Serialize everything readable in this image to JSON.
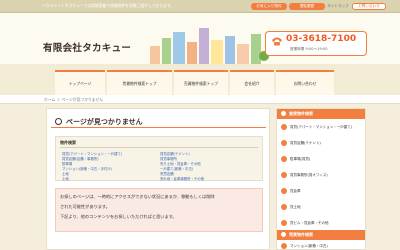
{
  "topbar": {
    "tagline": "ハウスメイトタカキューでは地域密着で賃貸物件を多数ご紹介しております。",
    "favorite_label": "お気に入り物件",
    "history_label": "閲覧履歴",
    "sitemap_label": "サイトマップ",
    "contact_label": "お問い合わせ"
  },
  "header": {
    "logo": "有限会社タカキュー",
    "phone": "03-3618-7100",
    "hours": "営業時間 9:00〜19:00"
  },
  "nav": {
    "items": [
      "トップページ",
      "賃貸物件検索トップ",
      "売買物件検索トップ",
      "会社紹介",
      "お問い合わせ"
    ]
  },
  "breadcrumb": {
    "text": "ホーム ＞ ページが見つかりません"
  },
  "main": {
    "title": "ページが見つかりません",
    "links_heading": "物件検索",
    "links_left": [
      "賃貸(アパート・マンション・一戸建て)",
      "賃貸店舗(店舗・事務所)",
      "駐車場",
      "マンション(新築・中古・手付け)",
      "土地",
      "土地"
    ],
    "links_right": [
      "賃貸店舗(テナント)",
      "賃貸事務所",
      "売り土地・貸倉庫・その他",
      "一戸建て(新築・中古)",
      "売買店舗",
      "売れ地・倉庫事務所・その他"
    ],
    "message_line1": "お探しのページは、一時的にアクセスができない状況にあるか、移動もしくは削除",
    "message_line2": "された可能性があります。",
    "message_line3": "下記より、他のコンテンツをお探しいただければと思います。"
  },
  "sidebar": {
    "heading": "賃貸物件検索",
    "items": [
      "賃貸(アパート・マンション・一戸建て)",
      "賃貸店舗(テナント)",
      "駐車場(賃貸)",
      "賃貸事務所(賃オフィス)",
      "貸倉庫",
      "貸土地",
      "貸ビル・貸倉庫・その他"
    ],
    "heading2": "売買物件検索",
    "items2": [
      "マンション(新築・中古)"
    ]
  },
  "colors": {
    "accent": "#f27e40",
    "link": "#3a64b8"
  }
}
